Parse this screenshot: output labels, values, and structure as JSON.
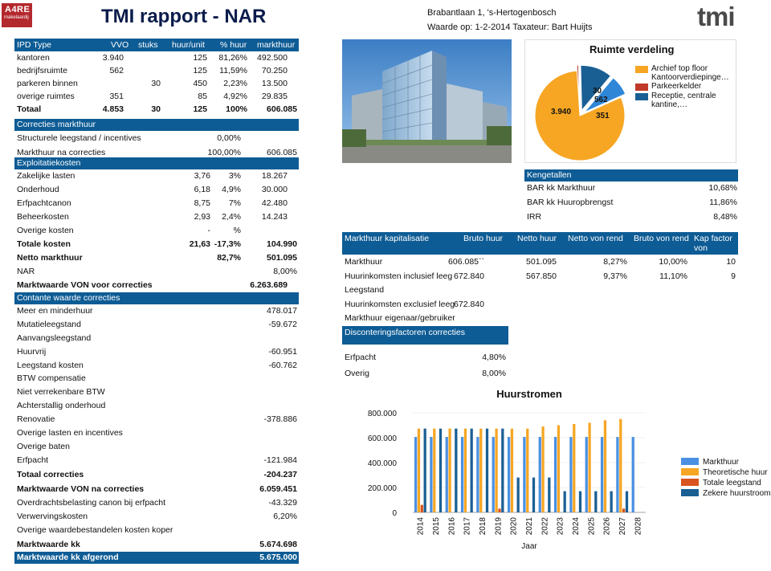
{
  "header": {
    "logo_main": "A4RE",
    "logo_sub": "makelaardij",
    "title": "TMI rapport - NAR",
    "address": "Brabantlaan 1, 's-Hertogenbosch",
    "valuation": "Waarde op: 1-2-2014 Taxateur: Bart Huijts",
    "logo_right": "tmi"
  },
  "ipd": {
    "columns": [
      "IPD Type",
      "VVO",
      "stuks",
      "huur/unit",
      "% huur",
      "markthuur"
    ],
    "rows": [
      [
        "kantoren",
        "3.940",
        "",
        "125",
        "81,26%",
        "492.500"
      ],
      [
        "bedrijfsruimte",
        "562",
        "",
        "125",
        "11,59%",
        "70.250"
      ],
      [
        "parkeren binnen",
        "",
        "30",
        "450",
        "2,23%",
        "13.500"
      ],
      [
        "overige ruimtes",
        "351",
        "",
        "85",
        "4,92%",
        "29.835"
      ]
    ],
    "total": [
      "Totaal",
      "4.853",
      "30",
      "125",
      "100%",
      "606.085"
    ]
  },
  "corrections": {
    "title": "Correcties markthuur",
    "rows": [
      [
        "Structurele leegstand / incentives",
        "0,00%",
        ""
      ],
      [
        "Markthuur na correcties",
        "100,00%",
        "606.085"
      ]
    ]
  },
  "exploitatie": {
    "title": "Exploitatiekosten",
    "rows": [
      [
        "Zakelijke lasten",
        "3,76",
        "3%",
        "18.267"
      ],
      [
        "Onderhoud",
        "6,18",
        "4,9%",
        "30.000"
      ],
      [
        "Erfpachtcanon",
        "8,75",
        "7%",
        "42.480"
      ],
      [
        "Beheerkosten",
        "2,93",
        "2,4%",
        "14.243"
      ],
      [
        "Overige kosten",
        "-",
        "%",
        ""
      ]
    ],
    "totale": [
      "Totale kosten",
      "21,63",
      "-17,3%",
      "104.990"
    ],
    "netto": [
      "Netto markthuur",
      "82,7%",
      "501.095"
    ],
    "nar": [
      "NAR",
      "8,00%"
    ],
    "mw_voor": [
      "Marktwaarde VON voor correcties",
      "6.263.689"
    ]
  },
  "contante": {
    "title": "Contante waarde correcties",
    "rows": [
      [
        "Meer en minderhuur",
        "478.017"
      ],
      [
        "Mutatieleegstand",
        "-59.672"
      ],
      [
        "Aanvangsleegstand",
        ""
      ],
      [
        "Huurvrij",
        "-60.951"
      ],
      [
        "Leegstand kosten",
        "-60.762"
      ],
      [
        "BTW compensatie",
        ""
      ],
      [
        "Niet verrekenbare BTW",
        ""
      ],
      [
        "Achterstallig onderhoud",
        ""
      ],
      [
        "Renovatie",
        "-378.886"
      ],
      [
        "Overige lasten en incentives",
        ""
      ],
      [
        "Overige baten",
        ""
      ],
      [
        "Erfpacht",
        "-121.984"
      ]
    ],
    "totaal": [
      "Totaal correcties",
      "-204.237"
    ],
    "mw_na": [
      "Marktwaarde VON na correcties",
      "6.059.451"
    ],
    "overdracht": [
      "Overdrachtsbelasting canon bij erfpacht",
      "-43.329"
    ],
    "verwerving": [
      "Verwervingskosten",
      "6,20%"
    ],
    "overige_waarde": [
      "Overige waardebestandelen kosten koper",
      ""
    ],
    "mw_kk": [
      "Marktwaarde kk",
      "5.674.698"
    ],
    "mw_afgerond": [
      "Marktwaarde kk afgerond",
      "5.675.000"
    ]
  },
  "pie": {
    "title": "Ruimte verdeling",
    "slices": [
      {
        "label": "Archief top floor Kantoorverdiepinge…",
        "value": 3940,
        "display": "3.940",
        "color": "#f6a623"
      },
      {
        "label": "Parkeerkelder",
        "value": 30,
        "display": "30",
        "color": "#c0392b"
      },
      {
        "label": "Receptie, centrale kantine,…",
        "value": 562,
        "display": "562",
        "color": "#1a5f94"
      },
      {
        "label": "",
        "value": 351,
        "display": "351",
        "color": "#2f86d6"
      }
    ],
    "legend": [
      "Archief top floor Kantoorverdiepinge…",
      "Parkeerkelder",
      "Receptie, centrale kantine,…"
    ]
  },
  "kengetallen": {
    "title": "Kengetallen",
    "rows": [
      [
        "BAR kk Markthuur",
        "10,68%"
      ],
      [
        "BAR kk Huuropbrengst",
        "11,86%"
      ],
      [
        "IRR",
        "8,48%"
      ]
    ]
  },
  "kapitalisatie": {
    "columns": [
      "Markthuur kapitalisatie",
      "Bruto huur",
      "Netto huur",
      "Netto von rend",
      "Bruto von rend",
      "Kap factor von"
    ],
    "rows": [
      [
        "Markthuur",
        "606.085``",
        "501.095",
        "8,27%",
        "10,00%",
        "10"
      ],
      [
        "Huurinkomsten inclusief leeg",
        "672.840",
        "567.850",
        "9,37%",
        "11,10%",
        "9"
      ],
      [
        "Leegstand",
        "",
        "",
        "",
        "",
        ""
      ],
      [
        "Huurinkomsten exclusief leeg",
        "672.840",
        "",
        "",
        "",
        ""
      ],
      [
        "Markthuur eigenaar/gebruiker",
        "",
        "",
        "",
        "",
        ""
      ]
    ]
  },
  "discontering": {
    "title": "Disconteringsfactoren correcties",
    "rows": [
      [
        "Erfpacht",
        "4,80%"
      ],
      [
        "Overig",
        "8,00%"
      ]
    ]
  },
  "chart_data": {
    "type": "bar",
    "title": "Huurstromen",
    "xlabel": "Jaar",
    "ylabel": "",
    "ylim": [
      0,
      800000
    ],
    "yticks": [
      "0",
      "200.000",
      "400.000",
      "600.000",
      "800.000"
    ],
    "categories": [
      "2014",
      "2015",
      "2016",
      "2017",
      "2018",
      "2019",
      "2020",
      "2021",
      "2022",
      "2023",
      "2024",
      "2025",
      "2026",
      "2027",
      "2028"
    ],
    "series": [
      {
        "name": "Markthuur",
        "color": "#4a90e2",
        "values": [
          606000,
          606000,
          606000,
          606000,
          606000,
          606000,
          606000,
          606000,
          606000,
          606000,
          606000,
          606000,
          606000,
          606000,
          606000
        ]
      },
      {
        "name": "Theoretische huur",
        "color": "#f6a623",
        "values": [
          673000,
          673000,
          673000,
          673000,
          673000,
          673000,
          673000,
          673000,
          690000,
          700000,
          710000,
          720000,
          740000,
          750000,
          0
        ]
      },
      {
        "name": "Totale leegstand",
        "color": "#d9541e",
        "values": [
          60000,
          0,
          0,
          0,
          0,
          30000,
          0,
          0,
          0,
          0,
          0,
          0,
          0,
          30000,
          0
        ]
      },
      {
        "name": "Zekere huurstroom",
        "color": "#1a5f94",
        "values": [
          673000,
          673000,
          673000,
          673000,
          673000,
          673000,
          280000,
          280000,
          280000,
          170000,
          170000,
          170000,
          170000,
          170000,
          0
        ]
      }
    ]
  }
}
